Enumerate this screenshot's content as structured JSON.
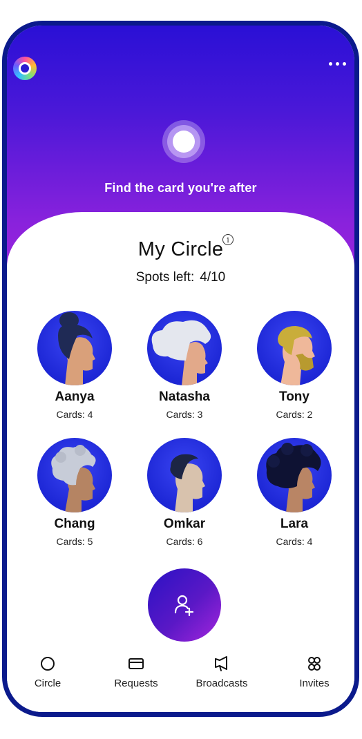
{
  "hero": {
    "tagline": "Find the card you're after"
  },
  "circle": {
    "title": "My Circle",
    "info_symbol": "i",
    "spots_label": "Spots left:",
    "spots_value": "4/10"
  },
  "members": [
    {
      "name": "Aanya",
      "cards": "Cards: 4"
    },
    {
      "name": "Natasha",
      "cards": "Cards: 3"
    },
    {
      "name": "Tony",
      "cards": "Cards: 2"
    },
    {
      "name": "Chang",
      "cards": "Cards: 5"
    },
    {
      "name": "Omkar",
      "cards": "Cards: 6"
    },
    {
      "name": "Lara",
      "cards": "Cards: 4"
    }
  ],
  "add_member": {
    "icon": "add-user-icon"
  },
  "nav": [
    {
      "label": "Circle",
      "icon": "circle-icon"
    },
    {
      "label": "Requests",
      "icon": "card-icon"
    },
    {
      "label": "Broadcasts",
      "icon": "megaphone-icon"
    },
    {
      "label": "Invites",
      "icon": "people-icon"
    }
  ],
  "colors": {
    "brand_blue": "#2a10d6",
    "brand_purple": "#9a24de",
    "frame": "#0b1a8c",
    "avatar_bg": "#1d27d6"
  }
}
